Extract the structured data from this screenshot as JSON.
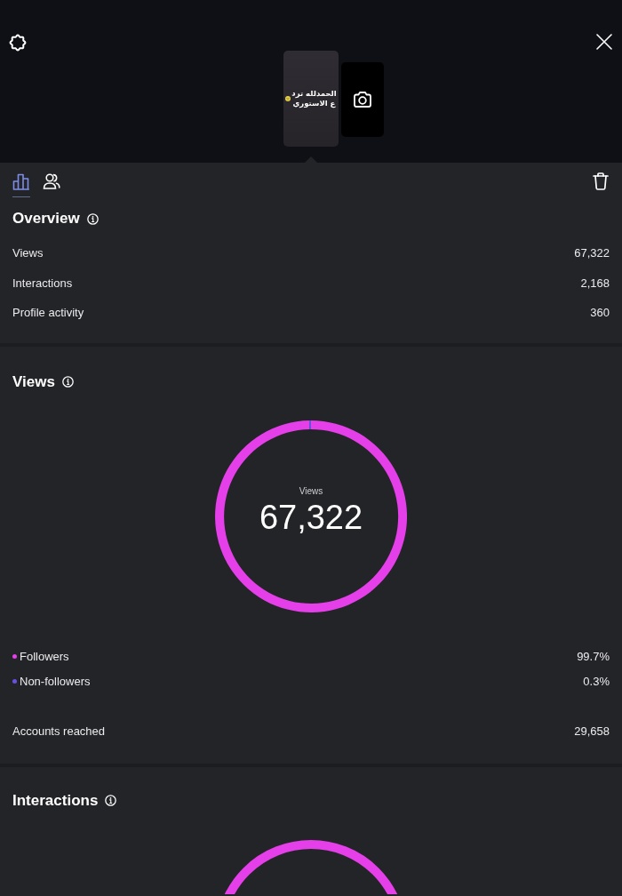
{
  "stories": [
    {
      "kind": "text",
      "caption": "الحمدلله ترد ع الاستوري",
      "selected": true
    },
    {
      "kind": "camera",
      "selected": false
    }
  ],
  "tabs": [
    {
      "kind": "chart",
      "selected": true
    },
    {
      "kind": "people",
      "selected": false
    }
  ],
  "overview": {
    "title": "Overview",
    "rows": [
      {
        "label": "Views",
        "value": "67,322"
      },
      {
        "label": "Interactions",
        "value": "2,168"
      },
      {
        "label": "Profile activity",
        "value": "360"
      }
    ]
  },
  "views": {
    "title": "Views",
    "total": "67,322",
    "chart_data": {
      "type": "donut",
      "title": "Views",
      "categories": [
        "Followers",
        "Non-followers"
      ],
      "values": [
        99.7,
        0.3
      ],
      "legend": "bottom"
    },
    "breakdown": [
      {
        "color": "#e43fe8",
        "value": "99.7%"
      },
      {
        "color": "#6a50e0",
        "value": "0.3%"
      }
    ],
    "accounts_reached": {
      "label": "Accounts reached",
      "value": "29,658"
    }
  },
  "interactions": {
    "title": "Interactions"
  }
}
